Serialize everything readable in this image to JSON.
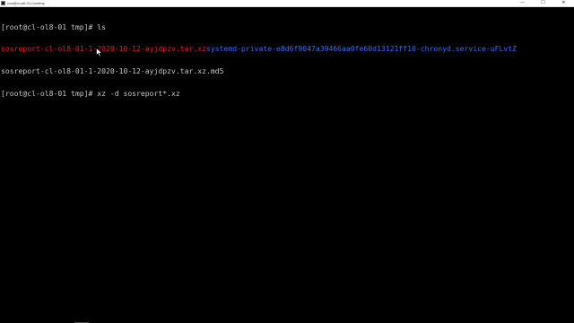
{
  "window": {
    "title": "root@cl-ol8-01:/var/tmp",
    "minimize_glyph": "—",
    "maximize_glyph": "☐",
    "close_glyph": "✕"
  },
  "terminal": {
    "prompt1": "[root@cl-ol8-01 tmp]# ls",
    "file_archive": "sosreport-cl-ol8-01-1-2020-10-12-ayjdpzv.tar.xz",
    "file_dir": "systemd-private-e8d6f9047a39466aa0fe60d13121ff10-chronyd.service-uFLvtZ",
    "file_md5": "sosreport-cl-ol8-01-1-2020-10-12-ayjdpzv.tar.xz.md5",
    "prompt2": "[root@cl-ol8-01 tmp]# xz -d sosreport*.xz"
  },
  "colors": {
    "background": "#000000",
    "text": "#c8c8c8",
    "archive": "#e02424",
    "directory": "#3a6cff"
  },
  "icons": {
    "app": "putty-terminal-icon",
    "pointer": "mouse-pointer-icon"
  }
}
